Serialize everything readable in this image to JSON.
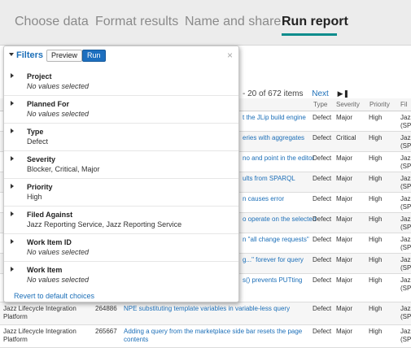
{
  "tabs": [
    {
      "label": "Choose data",
      "active": false
    },
    {
      "label": "Format results",
      "active": false
    },
    {
      "label": "Name and share",
      "active": false
    },
    {
      "label": "Run report",
      "active": true
    }
  ],
  "pager": {
    "range": "- 20 of 672 items",
    "next": "Next",
    "last_icon": "last-page-icon"
  },
  "columns": [
    "Type",
    "Severity",
    "Priority",
    "Fil"
  ],
  "rows": [
    {
      "summary": "t the JLip build engine",
      "type": "Defect",
      "severity": "Major",
      "priority": "High",
      "filed": "Jazz (SP"
    },
    {
      "summary": "eries with aggregates",
      "type": "Defect",
      "severity": "Critical",
      "priority": "High",
      "filed": "Jazz (SP"
    },
    {
      "summary": "no and point in the editor",
      "type": "Defect",
      "severity": "Major",
      "priority": "High",
      "filed": "Jazz (SP"
    },
    {
      "summary": "ults from SPARQL",
      "type": "Defect",
      "severity": "Major",
      "priority": "High",
      "filed": "Jazz (SP"
    },
    {
      "summary": "n causes error",
      "type": "Defect",
      "severity": "Major",
      "priority": "High",
      "filed": "Jazz (SP"
    },
    {
      "summary": "o operate on the selected",
      "type": "Defect",
      "severity": "Major",
      "priority": "High",
      "filed": "Jazz (SP"
    },
    {
      "summary": "n \"all change requests\"",
      "type": "Defect",
      "severity": "Major",
      "priority": "High",
      "filed": "Jazz (SP"
    },
    {
      "summary": "g...\" forever for query",
      "type": "Defect",
      "severity": "Major",
      "priority": "High",
      "filed": "Jazz (SP"
    },
    {
      "summary": "s() prevents PUTting",
      "type": "Defect",
      "severity": "Major",
      "priority": "High",
      "filed": "Jazz (SP"
    }
  ],
  "full_rows": [
    {
      "project": "Jazz Lifecycle Integration Platform",
      "id": "264886",
      "summary": "NPE substituting template variables in variable-less query",
      "type": "Defect",
      "severity": "Major",
      "priority": "High",
      "filed": "Jazz (SP"
    },
    {
      "project": "Jazz Lifecycle Integration Platform",
      "id": "265667",
      "summary": "Adding a query from the marketplace side bar resets the page contents",
      "type": "Defect",
      "severity": "Major",
      "priority": "High",
      "filed": "Jazz (SP"
    }
  ],
  "filters_panel": {
    "title": "Filters",
    "preview_label": "Preview",
    "run_label": "Run",
    "close_glyph": "×",
    "revert_label": "Revert to default choices",
    "items": [
      {
        "label": "Project",
        "value": "No values selected",
        "empty": true
      },
      {
        "label": "Planned For",
        "value": "No values selected",
        "empty": true
      },
      {
        "label": "Type",
        "value": "Defect",
        "empty": false
      },
      {
        "label": "Severity",
        "value": "Blocker, Critical, Major",
        "empty": false
      },
      {
        "label": "Priority",
        "value": "High",
        "empty": false
      },
      {
        "label": "Filed Against",
        "value": "Jazz Reporting Service, Jazz Reporting Service",
        "empty": false
      },
      {
        "label": "Work Item ID",
        "value": "No values selected",
        "empty": true
      },
      {
        "label": "Work Item",
        "value": "No values selected",
        "empty": true
      }
    ]
  },
  "colors": {
    "accent": "#0c8d8d",
    "link": "#1c6fb8",
    "run_button": "#1d6fbf"
  }
}
